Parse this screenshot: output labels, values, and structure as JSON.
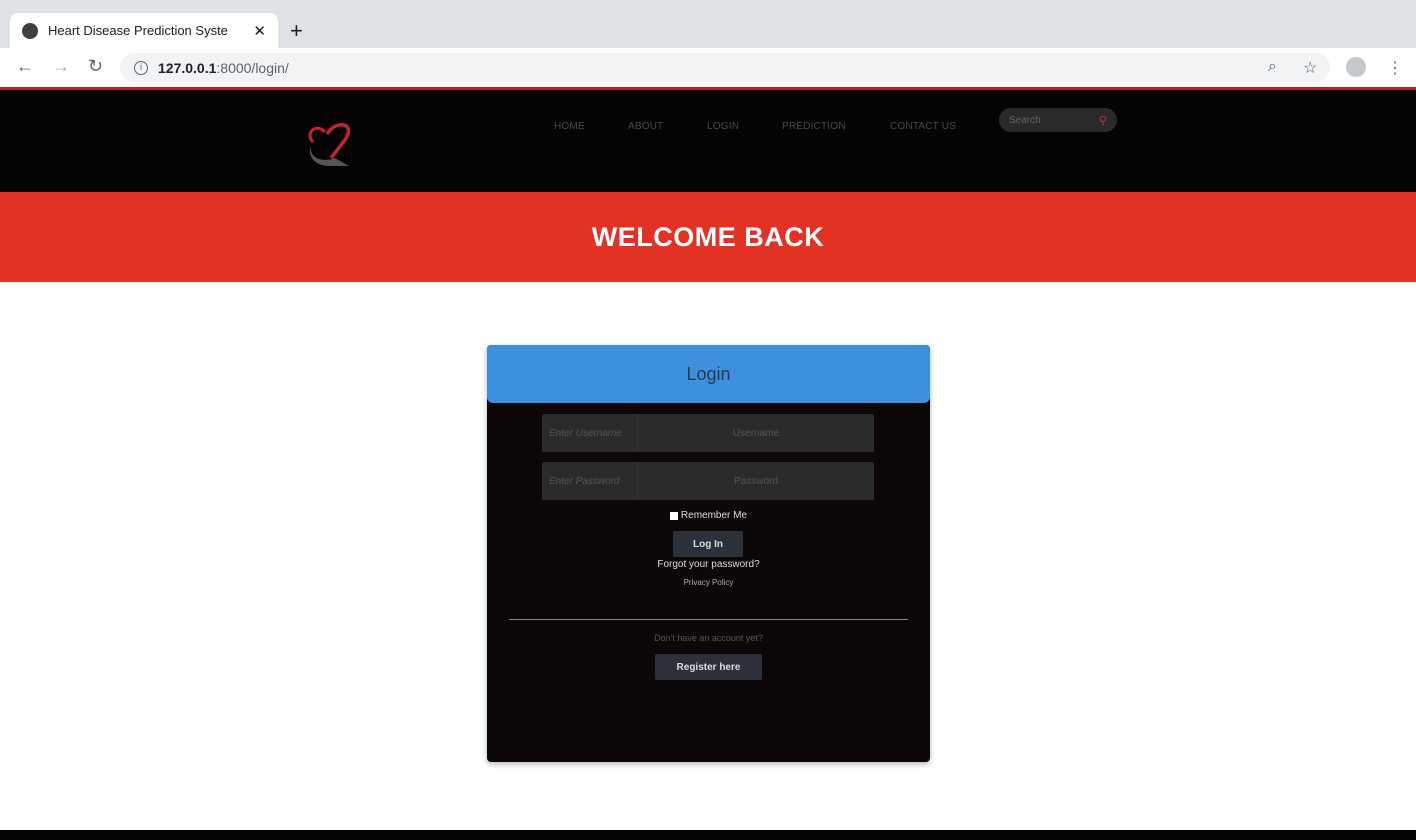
{
  "browser": {
    "tab_title": "Heart Disease Prediction Syste",
    "url_host": "127.0.0.1",
    "url_path": ":8000/login/"
  },
  "nav": {
    "links": [
      "HOME",
      "ABOUT",
      "LOGIN",
      "PREDICTION",
      "CONTACT US"
    ],
    "search_placeholder": "Search"
  },
  "banner": {
    "title": "WELCOME BACK"
  },
  "login": {
    "title": "Login",
    "username_label": "Enter Username",
    "username_placeholder": "Username",
    "password_label": "Enter Password",
    "password_placeholder": "Password",
    "remember": "Remember Me",
    "login_button": "Log In",
    "forgot": "Forgot your password?",
    "privacy": "Privacy Policy",
    "no_account": "Don't have an account yet?",
    "register_button": "Register here"
  },
  "colors": {
    "accent_red": "#e33224",
    "header_blue": "#3d8fdf",
    "card_bg": "#0d0707"
  }
}
